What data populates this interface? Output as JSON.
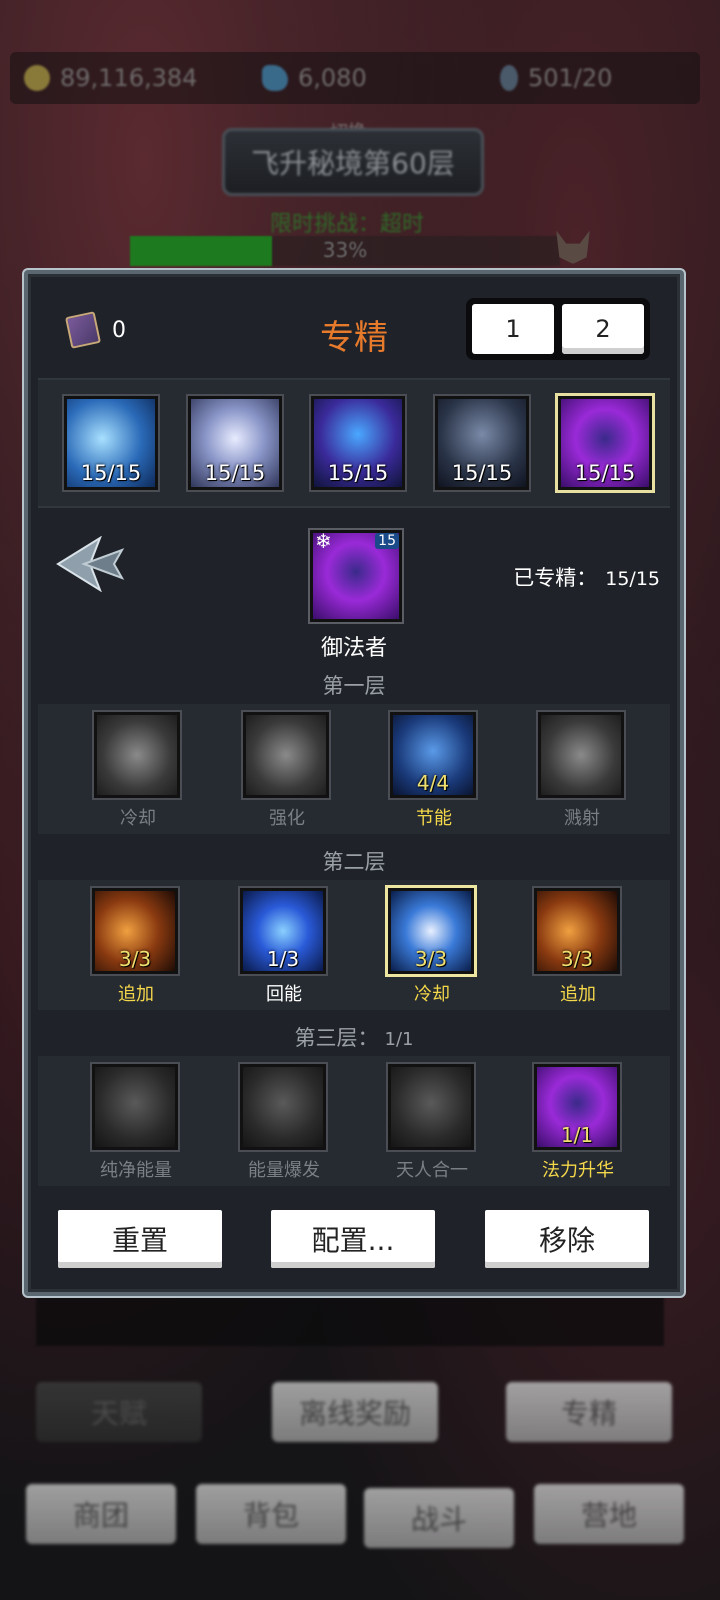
{
  "resources": {
    "gold": "89,116,384",
    "gems": "6,080",
    "keys": "501/20"
  },
  "stage": {
    "switch_label": "切换",
    "name": "飞升秘境第60层",
    "challenge": "限时挑战：超时",
    "progress_text": "33%",
    "progress": 0.33
  },
  "panel": {
    "book_count": "0",
    "title": "专精",
    "pages": [
      "1",
      "2"
    ],
    "specs": [
      {
        "count": "15/15",
        "icon": "ice-shards-icon"
      },
      {
        "count": "15/15",
        "icon": "arcane-rune-icon"
      },
      {
        "count": "15/15",
        "icon": "crystal-icon"
      },
      {
        "count": "15/15",
        "icon": "twins-icon"
      },
      {
        "count": "15/15",
        "icon": "arcane-mage-icon"
      }
    ],
    "hero": {
      "name": "御法者",
      "level": "15",
      "snow": "❄"
    },
    "spec_progress": {
      "label": "已专精：",
      "value": "15/15"
    },
    "tier1": {
      "title": "第一层",
      "skills": [
        {
          "name": "冷却",
          "count": ""
        },
        {
          "name": "强化",
          "count": ""
        },
        {
          "name": "节能",
          "count": "4/4"
        },
        {
          "name": "溅射",
          "count": ""
        }
      ]
    },
    "tier2": {
      "title": "第二层",
      "skills": [
        {
          "name": "追加",
          "count": "3/3"
        },
        {
          "name": "回能",
          "count": "1/3"
        },
        {
          "name": "冷却",
          "count": "3/3"
        },
        {
          "name": "追加",
          "count": "3/3"
        }
      ]
    },
    "tier3": {
      "title": "第三层：",
      "value": "1/1",
      "skills": [
        {
          "name": "纯净能量",
          "count": ""
        },
        {
          "name": "能量爆发",
          "count": ""
        },
        {
          "name": "天人合一",
          "count": ""
        },
        {
          "name": "法力升华",
          "count": "1/1"
        }
      ]
    },
    "buttons": {
      "reset": "重置",
      "config": "配置...",
      "remove": "移除"
    }
  },
  "bottom": {
    "row1": [
      "天赋",
      "离线奖励",
      "专精"
    ],
    "row2": [
      "商团",
      "背包",
      "战斗",
      "营地"
    ]
  },
  "colors": {
    "title": "#e87a2c",
    "gold_text": "#f5d84a",
    "gray_text": "#7a7f85"
  }
}
